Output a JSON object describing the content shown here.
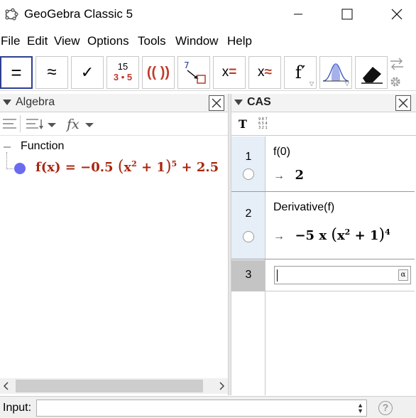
{
  "window": {
    "title": "GeoGebra Classic 5"
  },
  "menu": [
    "File",
    "Edit",
    "View",
    "Options",
    "Tools",
    "Window",
    "Help"
  ],
  "toolbar": {
    "tools": [
      {
        "name": "evaluate",
        "label": "="
      },
      {
        "name": "numeric",
        "label": "≈"
      },
      {
        "name": "keep-input",
        "label": "✓"
      },
      {
        "name": "factor",
        "label_top": "15",
        "label_bottom": "3 • 5"
      },
      {
        "name": "expand",
        "label": "(( ))"
      },
      {
        "name": "substitute",
        "label": "7"
      },
      {
        "name": "solve",
        "label": "x="
      },
      {
        "name": "solve-numerically",
        "label": "x≈"
      },
      {
        "name": "derivative",
        "label": "f′"
      },
      {
        "name": "probability-calculator",
        "label": ""
      },
      {
        "name": "delete",
        "label": ""
      }
    ],
    "accent_color": "#2e3f8f",
    "red_color": "#c0392b"
  },
  "algebra": {
    "title": "Algebra",
    "group_label": "Function",
    "function_expression": {
      "lhs": "f(x) = −0.5",
      "inner": "x",
      "inner_exp": "2",
      "inner_plus": "+ 1",
      "outer_exp": "5",
      "tail": "+ 2.5"
    },
    "function_color": "#a8260e",
    "point_color": "#6b6bf2"
  },
  "cas": {
    "title": "CAS",
    "toggle_text_label": "T",
    "numpad_label": "9 8 7\n6 5 4\n3 2 1",
    "rows": [
      {
        "num": "1",
        "input": "f(0)",
        "output": "2"
      },
      {
        "num": "2",
        "input": "Derivative(f)",
        "output_coef": "−5 x",
        "output_inner": "x",
        "output_inner_exp": "2",
        "output_inner_plus": "+ 1",
        "output_outer_exp": "4"
      },
      {
        "num": "3",
        "input": ""
      }
    ],
    "arrow": "→",
    "alpha_button": "α"
  },
  "inputbar": {
    "label": "Input:",
    "value": "",
    "help": "?"
  }
}
